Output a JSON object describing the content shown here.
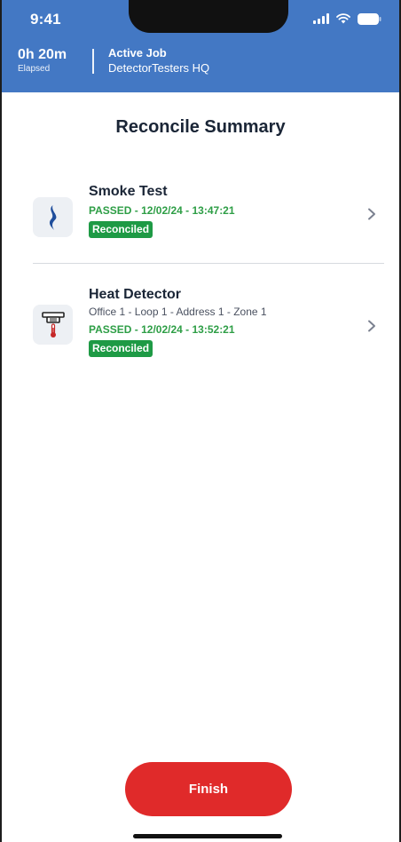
{
  "status_bar": {
    "time": "9:41"
  },
  "header": {
    "elapsed_value": "0h 20m",
    "elapsed_label": "Elapsed",
    "job_title": "Active Job",
    "job_name": "DetectorTesters HQ",
    "background_color": "#4378c4"
  },
  "page": {
    "title": "Reconcile Summary"
  },
  "items": [
    {
      "icon": "smoke-icon",
      "title": "Smoke Test",
      "result": "PASSED - 12/02/24 - 13:47:21",
      "badge": "Reconciled"
    },
    {
      "icon": "heat-detector-icon",
      "title": "Heat Detector",
      "location": "Office 1  - Loop 1  - Address 1  - Zone 1",
      "result": "PASSED - 12/02/24 - 13:52:21",
      "badge": "Reconciled"
    }
  ],
  "footer": {
    "finish_label": "Finish",
    "finish_color": "#e02a2a"
  },
  "colors": {
    "passed": "#2e9e46",
    "badge": "#1e9a45"
  }
}
